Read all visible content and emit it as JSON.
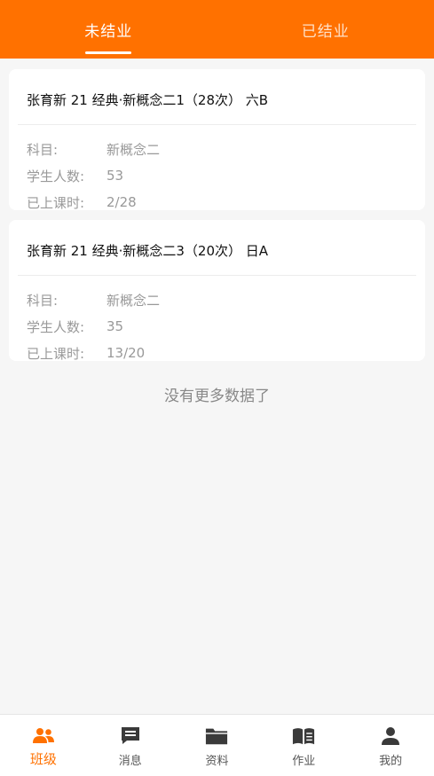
{
  "tabs": [
    {
      "label": "未结业",
      "active": true
    },
    {
      "label": "已结业",
      "active": false
    }
  ],
  "classes": [
    {
      "title": "张育新 21 经典·新概念二1（28次） 六B",
      "subject_label": "科目:",
      "subject": "新概念二",
      "students_label": "学生人数:",
      "students": "53",
      "progress_label": "已上课时:",
      "progress": "2/28"
    },
    {
      "title": "张育新 21 经典·新概念二3（20次） 日A",
      "subject_label": "科目:",
      "subject": "新概念二",
      "students_label": "学生人数:",
      "students": "35",
      "progress_label": "已上课时:",
      "progress": "13/20"
    }
  ],
  "no_more_text": "没有更多数据了",
  "bottom_nav": [
    {
      "label": "班级",
      "icon": "class-icon",
      "active": true
    },
    {
      "label": "消息",
      "icon": "message-icon",
      "active": false
    },
    {
      "label": "资料",
      "icon": "folder-icon",
      "active": false
    },
    {
      "label": "作业",
      "icon": "book-icon",
      "active": false
    },
    {
      "label": "我的",
      "icon": "user-icon",
      "active": false
    }
  ],
  "colors": {
    "accent": "#ff7100",
    "inactive_icon": "#3a3a3a"
  }
}
